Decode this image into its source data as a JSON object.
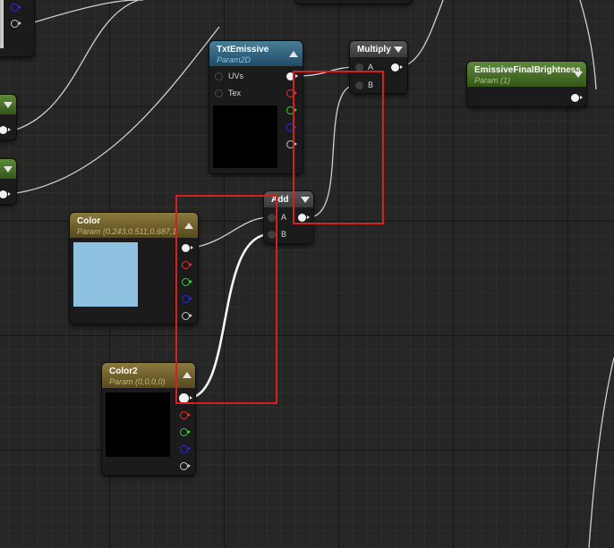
{
  "colors": {
    "highlight": "#d62020",
    "color_swatch": "#8ec2e0",
    "color2_swatch": "#000000",
    "txt_preview": "#000000"
  },
  "nodes": {
    "txt_emissive": {
      "title": "TxtEmissive",
      "subtitle": "Param2D",
      "inputs": [
        "UVs",
        "Tex"
      ]
    },
    "multiply": {
      "title": "Multiply",
      "inputs": [
        "A",
        "B"
      ]
    },
    "emissive_final": {
      "title": "EmissiveFinalBrightness",
      "subtitle": "Param (1)"
    },
    "add": {
      "title": "Add",
      "inputs": [
        "A",
        "B"
      ]
    },
    "color": {
      "title": "Color",
      "subtitle": "Param (0.243,0.511,0.687,1"
    },
    "color2": {
      "title": "Color2",
      "subtitle": "Param (0,0,0,0)"
    }
  }
}
